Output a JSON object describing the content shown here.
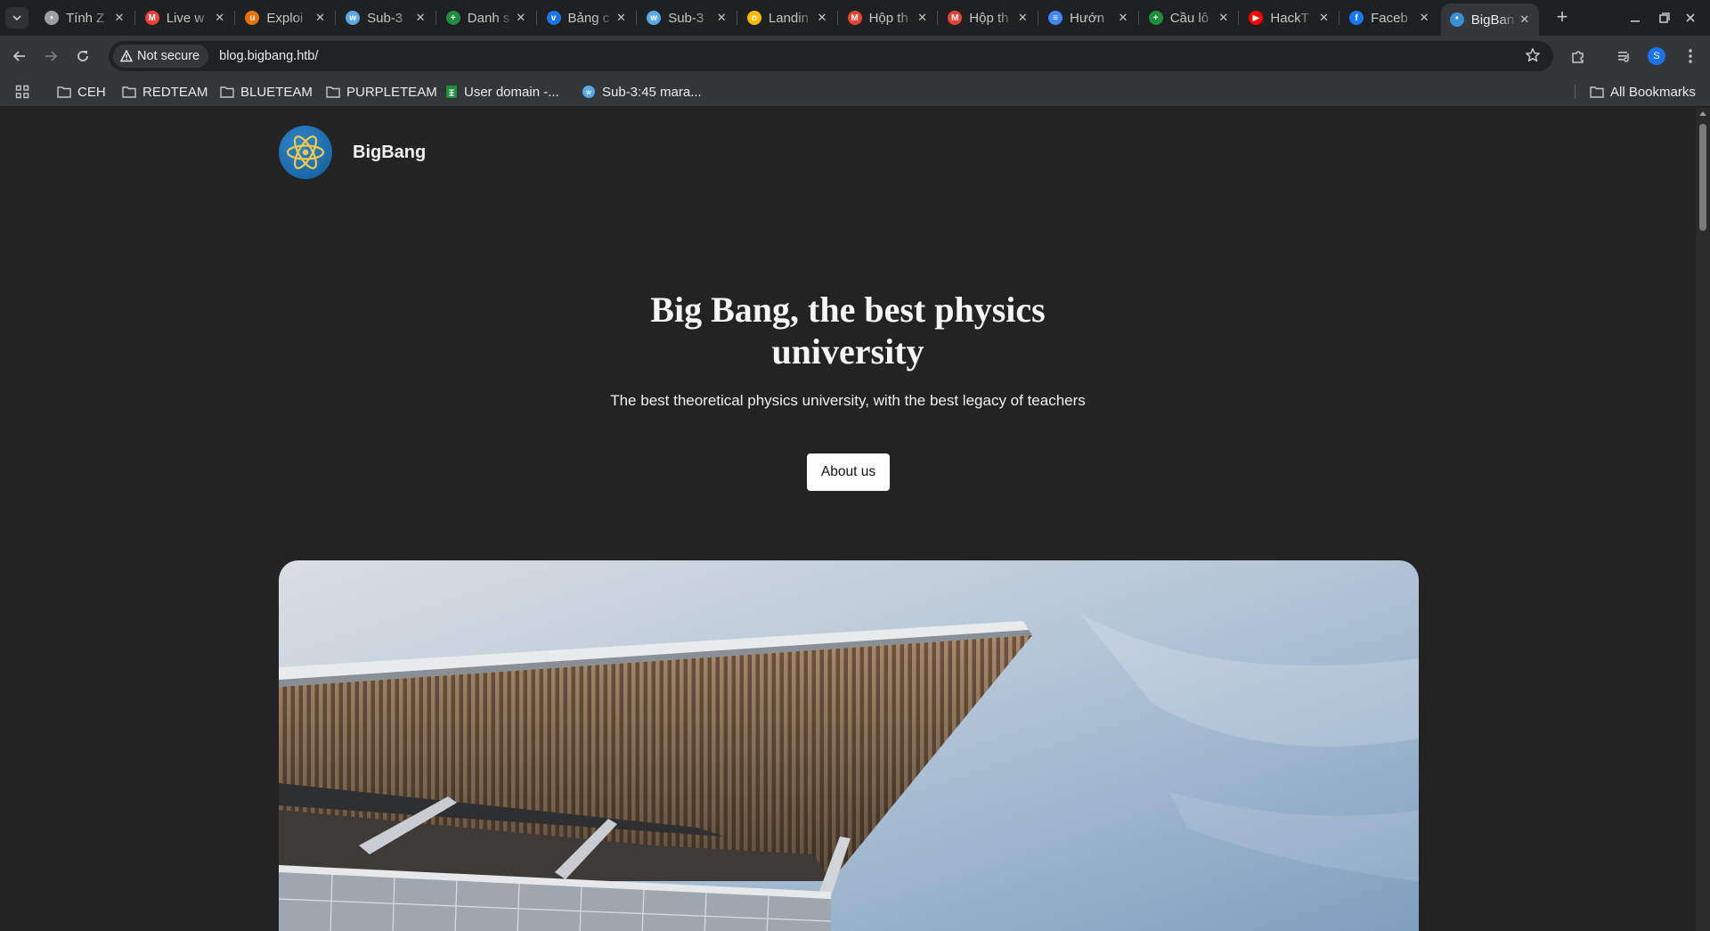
{
  "browser": {
    "tabs": [
      {
        "title": "Tính Z",
        "favicon": "globe-icon",
        "color": "#9aa0a6"
      },
      {
        "title": "Live w",
        "favicon": "gmail-icon",
        "color": "#ea4335"
      },
      {
        "title": "Exploi",
        "favicon": "ublock-icon",
        "color": "#e8710a"
      },
      {
        "title": "Sub-3",
        "favicon": "wp-icon",
        "color": "#5aa9e6"
      },
      {
        "title": "Danh s",
        "favicon": "sheets-icon",
        "color": "#1e8e3e"
      },
      {
        "title": "Bảng c",
        "favicon": "bird-icon",
        "color": "#1a73e8"
      },
      {
        "title": "Sub-3",
        "favicon": "wp-icon",
        "color": "#5aa9e6"
      },
      {
        "title": "Landin",
        "favicon": "ring-icon",
        "color": "#fbbc04"
      },
      {
        "title": "Hộp th",
        "favicon": "gmail-icon",
        "color": "#ea4335"
      },
      {
        "title": "Hộp th",
        "favicon": "gmail-icon",
        "color": "#ea4335"
      },
      {
        "title": "Hướn",
        "favicon": "docs-icon",
        "color": "#4285f4"
      },
      {
        "title": "Cầu lô",
        "favicon": "sheets-icon",
        "color": "#1e8e3e"
      },
      {
        "title": "HackT",
        "favicon": "youtube-icon",
        "color": "#ff0000"
      },
      {
        "title": "Faceb",
        "favicon": "facebook-icon",
        "color": "#1877f2"
      },
      {
        "title": "BigBan",
        "favicon": "atom-icon",
        "color": "#3a8fd4",
        "active": true
      }
    ],
    "security_label": "Not secure",
    "url": "blog.bigbang.htb/",
    "profile_initial": "S",
    "bookmarks": [
      {
        "label": "CEH",
        "icon": "folder-icon"
      },
      {
        "label": "REDTEAM",
        "icon": "folder-icon"
      },
      {
        "label": "BLUETEAM",
        "icon": "folder-icon"
      },
      {
        "label": "PURPLETEAM",
        "icon": "folder-icon"
      },
      {
        "label": "User domain -...",
        "icon": "sheets-icon"
      },
      {
        "label": "Sub-3:45 mara...",
        "icon": "wp-icon"
      }
    ],
    "all_bookmarks_label": "All Bookmarks"
  },
  "site": {
    "brand": "BigBang",
    "hero_title": "Big Bang, the best physics university",
    "hero_subtitle": "The best theoretical physics university, with the best legacy of teachers",
    "cta_label": "About us"
  },
  "colors": {
    "page_bg": "#232323",
    "logo_blue": "#1f6fb2",
    "logo_gold": "#f2c94c",
    "cta_bg": "#ffffff"
  }
}
